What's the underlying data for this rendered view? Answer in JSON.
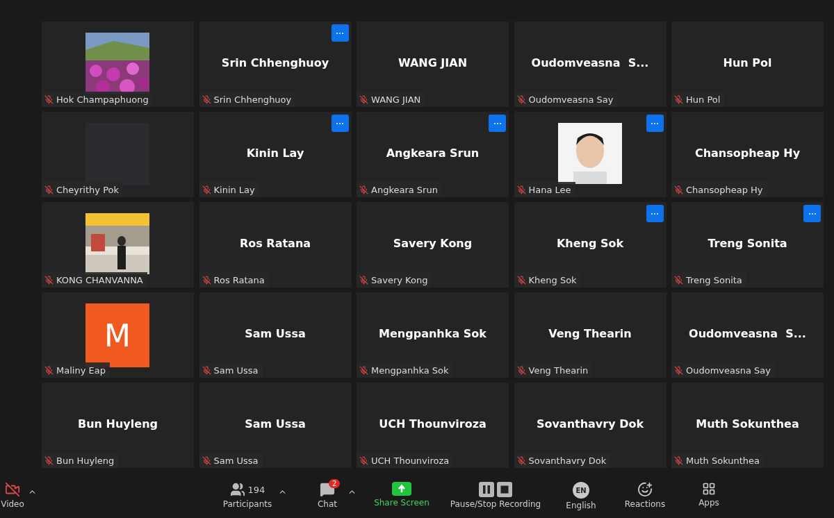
{
  "tiles": [
    {
      "kind": "picture",
      "name": "Hok Champaphuong",
      "muted": true,
      "menu": false
    },
    {
      "kind": "name",
      "title": "Srin Chhenghuoy",
      "name": "Srin Chhenghuoy",
      "muted": true,
      "menu": true
    },
    {
      "kind": "name",
      "title": "WANG JIAN",
      "name": "WANG JIAN",
      "muted": true,
      "menu": false
    },
    {
      "kind": "name",
      "title": "Oudomveasna  S...",
      "name": "Oudomveasna Say",
      "muted": true,
      "menu": false
    },
    {
      "kind": "name",
      "title": "Hun Pol",
      "name": "Hun Pol",
      "muted": true,
      "menu": false
    },
    {
      "kind": "blank",
      "name": "Cheyrithy Pok",
      "muted": true,
      "menu": false
    },
    {
      "kind": "name",
      "title": "Kinin Lay",
      "name": "Kinin Lay",
      "muted": true,
      "menu": true
    },
    {
      "kind": "name",
      "title": "Angkeara Srun",
      "name": "Angkeara Srun",
      "muted": true,
      "menu": true
    },
    {
      "kind": "picture",
      "name": "Hana Lee",
      "muted": true,
      "menu": true
    },
    {
      "kind": "name",
      "title": "Chansopheap Hy",
      "name": "Chansopheap Hy",
      "muted": true,
      "menu": false
    },
    {
      "kind": "picture",
      "name": "KONG CHANVANNA",
      "muted": true,
      "menu": false
    },
    {
      "kind": "name",
      "title": "Ros Ratana",
      "name": "Ros Ratana",
      "muted": true,
      "menu": false
    },
    {
      "kind": "name",
      "title": "Savery Kong",
      "name": "Savery Kong",
      "muted": true,
      "menu": false
    },
    {
      "kind": "name",
      "title": "Kheng Sok",
      "name": "Kheng Sok",
      "muted": true,
      "menu": true
    },
    {
      "kind": "name",
      "title": "Treng Sonita",
      "name": "Treng Sonita",
      "muted": true,
      "menu": true
    },
    {
      "kind": "letter",
      "initial": "M",
      "name": "Maliny Eap",
      "muted": true,
      "menu": false
    },
    {
      "kind": "name",
      "title": "Sam Ussa",
      "name": "Sam Ussa",
      "muted": true,
      "menu": false
    },
    {
      "kind": "name",
      "title": "Mengpanhka Sok",
      "name": "Mengpanhka Sok",
      "muted": true,
      "menu": false
    },
    {
      "kind": "name",
      "title": "Veng Thearin",
      "name": "Veng Thearin",
      "muted": true,
      "menu": false
    },
    {
      "kind": "name",
      "title": "Oudomveasna  S...",
      "name": "Oudomveasna Say",
      "muted": true,
      "menu": false
    },
    {
      "kind": "name",
      "title": "Bun Huyleng",
      "name": "Bun Huyleng",
      "muted": true,
      "menu": false
    },
    {
      "kind": "name",
      "title": "Sam Ussa",
      "name": "Sam Ussa",
      "muted": true,
      "menu": false
    },
    {
      "kind": "name",
      "title": "UCH Thounviroza",
      "name": "UCH Thounviroza",
      "muted": true,
      "menu": false
    },
    {
      "kind": "name",
      "title": "Sovanthavry Dok",
      "name": "Sovanthavry Dok",
      "muted": true,
      "menu": false
    },
    {
      "kind": "name",
      "title": "Muth Sokunthea",
      "name": "Muth Sokunthea",
      "muted": true,
      "menu": false
    }
  ],
  "toolbar": {
    "video": {
      "label": "Video",
      "on": false
    },
    "participants": {
      "label": "Participants",
      "count": "194"
    },
    "chat": {
      "label": "Chat",
      "badge": "2"
    },
    "share": {
      "label": "Share Screen"
    },
    "recording": {
      "label": "Pause/Stop Recording"
    },
    "language": {
      "label": "English",
      "code": "EN"
    },
    "reactions": {
      "label": "Reactions"
    },
    "apps": {
      "label": "Apps"
    }
  }
}
